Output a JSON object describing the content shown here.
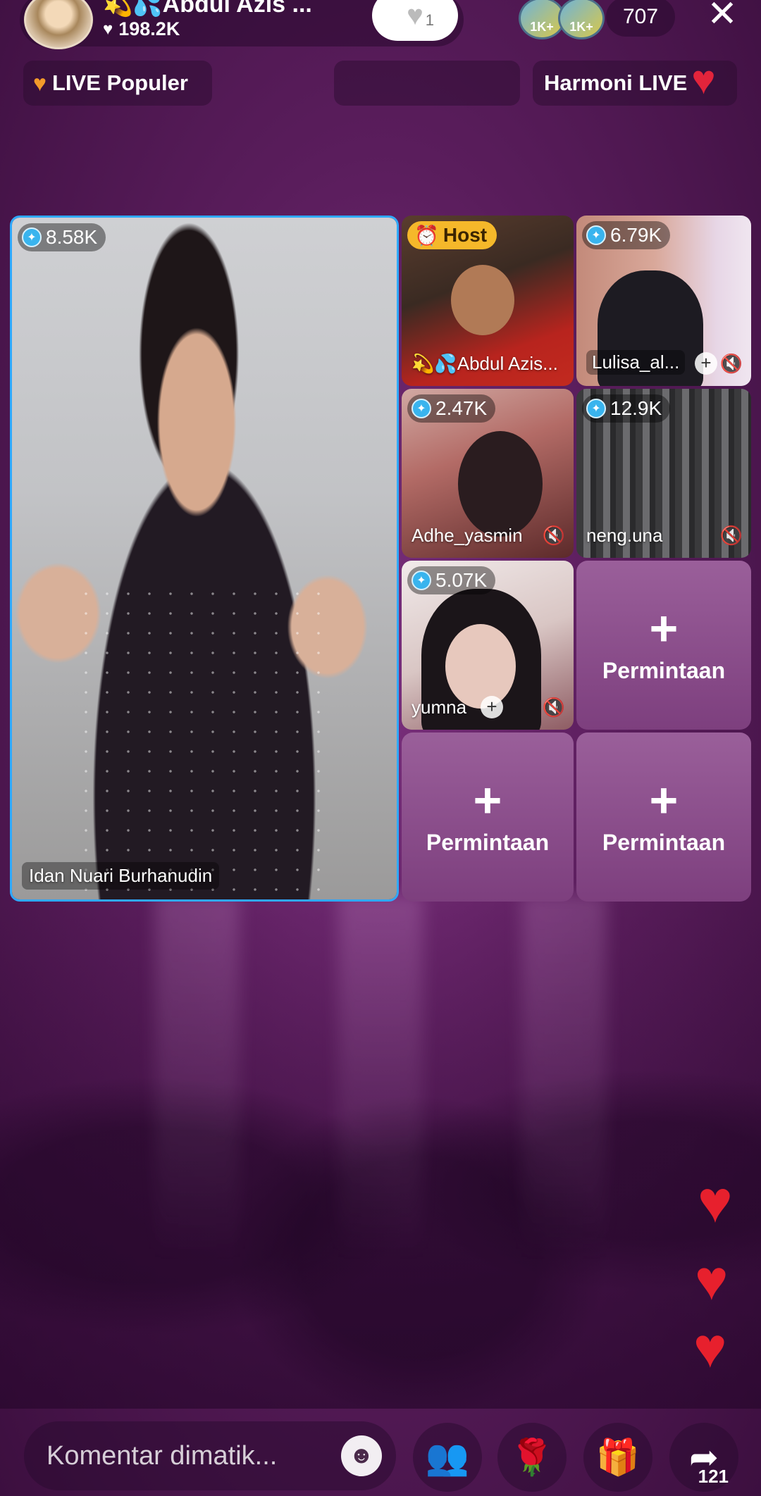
{
  "top": {
    "host_name": "💫💦Abdul Azis ...",
    "likes": "198.2K",
    "follow_count": "1",
    "viewer_badges": [
      "1K+",
      "1K+"
    ],
    "viewer_count": "707"
  },
  "pills": {
    "popular": "LIVE Populer",
    "harmoni": "Harmoni LIVE"
  },
  "tiles": {
    "main": {
      "score": "8.58K",
      "name": "Idan Nuari Burhanudin"
    },
    "host": {
      "badge": "Host",
      "name": "💫💦Abdul Azis..."
    },
    "t2": {
      "score": "6.79K",
      "name": "Lulisa_al..."
    },
    "t3": {
      "score": "2.47K",
      "name": "Adhe_yasmin"
    },
    "t4": {
      "score": "12.9K",
      "name": "neng.una"
    },
    "t5": {
      "score": "5.07K",
      "name": "yumna"
    },
    "request_label": "Permintaan"
  },
  "bottom": {
    "comment_placeholder": "Komentar dimatik...",
    "share_count": "121"
  },
  "colors": {
    "background": "#5a1d5c",
    "main_tile_border": "#2fa9ff",
    "host_badge": "#f5b82a",
    "request_tile": "#8a4f8a",
    "heart": "#e7202d"
  }
}
